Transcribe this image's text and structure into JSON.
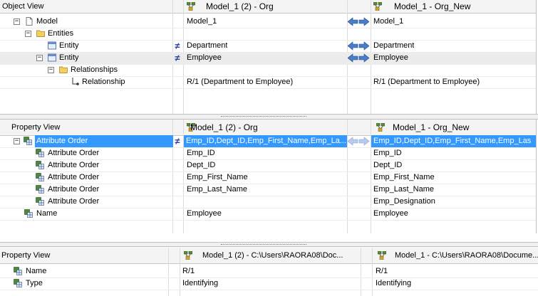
{
  "object_view": {
    "headers": {
      "tree": "Object View",
      "left": "Model_1 (2)  -  Org",
      "right": "Model_1  -  Org_New"
    },
    "rows": [
      {
        "label": "Model",
        "left": "Model_1",
        "right": "Model_1"
      },
      {
        "label": "Entities",
        "left": "",
        "right": ""
      },
      {
        "label": "Entity",
        "left": "Department",
        "right": "Department"
      },
      {
        "label": "Entity",
        "left": "Employee",
        "right": "Employee"
      },
      {
        "label": "Relationships",
        "left": "",
        "right": ""
      },
      {
        "label": "Relationship",
        "left": "R/1 (Department to Employee)",
        "right": "R/1 (Department to Employee)"
      }
    ]
  },
  "property_view": {
    "headers": {
      "tree": "Property View",
      "left": "Model_1 (2)  -  Org",
      "right": "Model_1  -  Org_New"
    },
    "rows": [
      {
        "label": "Attribute Order",
        "left": "Emp_ID,Dept_ID,Emp_First_Name,Emp_La...",
        "right": "Emp_ID,Dept_ID,Emp_First_Name,Emp_Las"
      },
      {
        "label": "Attribute Order",
        "left": "Emp_ID",
        "right": "Emp_ID"
      },
      {
        "label": "Attribute Order",
        "left": "Dept_ID",
        "right": "Dept_ID"
      },
      {
        "label": "Attribute Order",
        "left": "Emp_First_Name",
        "right": "Emp_First_Name"
      },
      {
        "label": "Attribute Order",
        "left": "Emp_Last_Name",
        "right": "Emp_Last_Name"
      },
      {
        "label": "Attribute Order",
        "left": "",
        "right": "Emp_Designation"
      },
      {
        "label": "Name",
        "left": "Employee",
        "right": "Employee"
      }
    ]
  },
  "bottom_view": {
    "headers": {
      "tree": "Property View",
      "left": "Model_1 (2) - C:\\Users\\RAORA08\\Doc...",
      "right": "Model_1 - C:\\Users\\RAORA08\\Docume..."
    },
    "rows": [
      {
        "label": "Name",
        "left": "R/1",
        "right": "R/1"
      },
      {
        "label": "Type",
        "left": "Identifying",
        "right": "Identifying"
      }
    ]
  },
  "colors": {
    "selection": "#3399ff",
    "arrow": "#4a7ec8",
    "not_equal": "#2a3f9e"
  }
}
